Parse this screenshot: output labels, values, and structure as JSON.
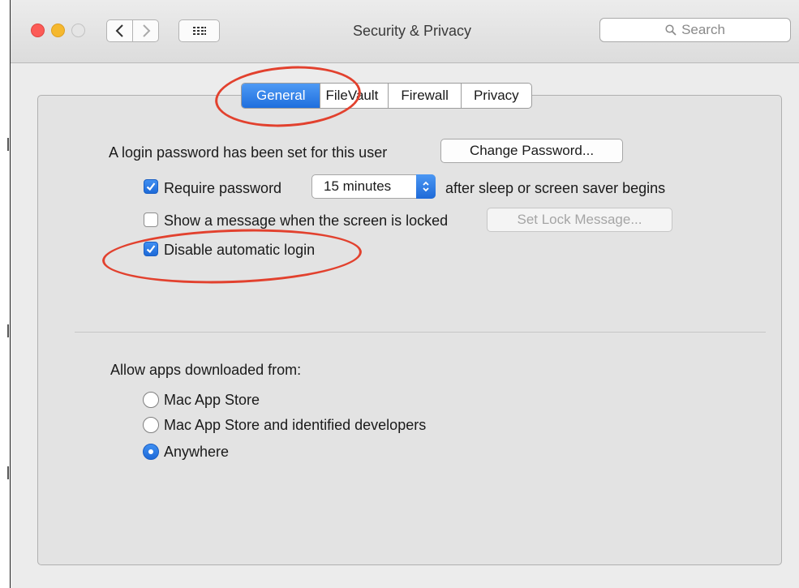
{
  "window": {
    "title": "Security & Privacy",
    "search_placeholder": "Search"
  },
  "tabs": [
    {
      "label": "General",
      "active": true
    },
    {
      "label": "FileVault",
      "active": false
    },
    {
      "label": "Firewall",
      "active": false
    },
    {
      "label": "Privacy",
      "active": false
    }
  ],
  "general": {
    "login_password_text": "A login password has been set for this user",
    "change_password_label": "Change Password...",
    "require_password": {
      "label": "Require password",
      "checked": true
    },
    "require_interval": "15 minutes",
    "require_suffix": "after sleep or screen saver begins",
    "show_message": {
      "label": "Show a message when the screen is locked",
      "checked": false
    },
    "set_lock_message_label": "Set Lock Message...",
    "disable_auto_login": {
      "label": "Disable automatic login",
      "checked": true
    }
  },
  "downloads": {
    "heading": "Allow apps downloaded from:",
    "options": [
      {
        "label": "Mac App Store",
        "selected": false
      },
      {
        "label": "Mac App Store and identified developers",
        "selected": false
      },
      {
        "label": "Anywhere",
        "selected": true
      }
    ]
  },
  "colors": {
    "accent": "#1f6fde",
    "annotation": "#e2412e"
  }
}
